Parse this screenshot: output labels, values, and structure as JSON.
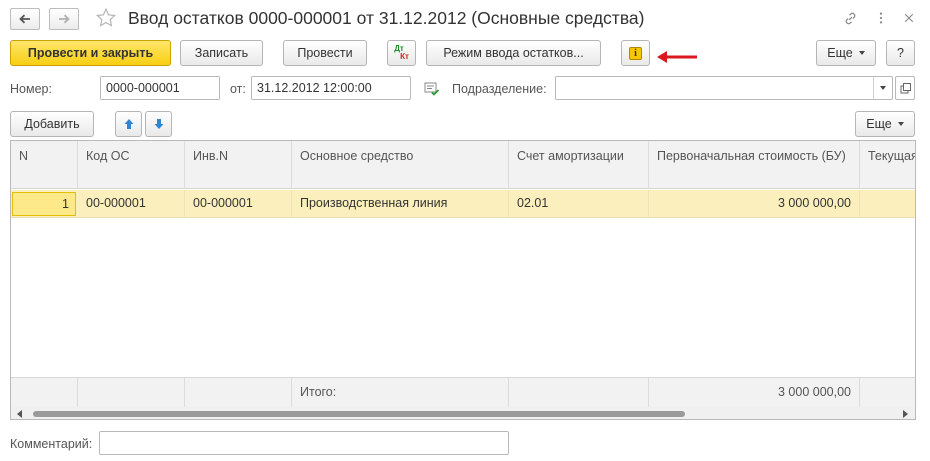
{
  "window": {
    "title": "Ввод остатков 0000-000001 от 31.12.2012 (Основные средства)"
  },
  "toolbar": {
    "post_and_close": "Провести и закрыть",
    "save": "Записать",
    "post": "Провести",
    "dt_kt_top": "Дт",
    "dt_kt_bottom": "Кт",
    "balance_mode": "Режим ввода остатков...",
    "info_glyph": "i",
    "more": "Еще",
    "help": "?"
  },
  "form": {
    "number_label": "Номер:",
    "number_value": "0000-000001",
    "date_label": "от:",
    "date_value": "31.12.2012 12:00:00",
    "division_label": "Подразделение:",
    "division_value": ""
  },
  "table_toolbar": {
    "add": "Добавить",
    "more": "Еще"
  },
  "table": {
    "columns": [
      "N",
      "Код ОС",
      "Инв.N",
      "Основное средство",
      "Счет амортизации",
      "Первоначальная стоимость (БУ)",
      "Текущая"
    ],
    "rows": [
      {
        "n": "1",
        "code": "00-000001",
        "inv": "00-000001",
        "asset": "Производственная линия",
        "account": "02.01",
        "cost": "3 000 000,00"
      }
    ],
    "footer": {
      "total_label": "Итого:",
      "total_cost": "3 000 000,00"
    }
  },
  "comment": {
    "label": "Комментарий:",
    "value": ""
  },
  "colors": {
    "accent_yellow": "#f8cf12",
    "selected_row": "#fbf0bd",
    "annotation_arrow": "#d9191c"
  }
}
